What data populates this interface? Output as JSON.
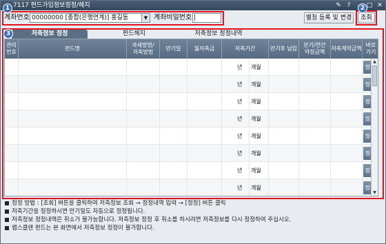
{
  "window": {
    "title": "7117 펀드가입정보정정/해지",
    "controls": [
      "pin-icon",
      "help-icon",
      "minimize-icon",
      "maximize-icon",
      "close-icon"
    ]
  },
  "markers": [
    "1",
    "2",
    "3"
  ],
  "account": {
    "label": "계좌번호",
    "value": "00000000 [종합(은행연계)] 홍길동",
    "password_label": "계좌비밀번호",
    "password_value": "|"
  },
  "buttons": {
    "register_change": "별청 등록 및 변경",
    "search": "조회"
  },
  "tabs": [
    "저축정보 정정",
    "펀드해지",
    "저축정보 정정내역"
  ],
  "grid": {
    "columns": [
      "관리\n번호",
      "펀드명",
      "과세방법/\n저축방법",
      "만기일",
      "월저축금",
      "저축기간",
      "만기후 납입",
      "분기/연간\n약정금액",
      "저축계약금액",
      "바로\n가기"
    ],
    "rows": [
      {
        "year": "년",
        "month": "개월",
        "action": "정정"
      },
      {
        "year": "년",
        "month": "개월",
        "action": "정정"
      },
      {
        "year": "년",
        "month": "개월",
        "action": "정정"
      },
      {
        "year": "년",
        "month": "개월",
        "action": "정정"
      },
      {
        "year": "년",
        "month": "개월",
        "action": "정정"
      },
      {
        "year": "년",
        "month": "개월",
        "action": "정정"
      },
      {
        "year": "년",
        "month": "개월",
        "action": "정정"
      },
      {
        "year": "년",
        "month": "개월",
        "action": "정정"
      }
    ]
  },
  "notes": [
    "정정 방법 : [조회] 버튼을 클릭하여 저축정보 조회 → 정정내역 입력 → [정정] 버튼 클릭",
    "저축기간을 정정하시면 만기일도 자동으로 정정됩니다.",
    "저축정보 정정내역은 취소가 불가능합니다. 저축정보 정정 후 취소를 하시려면 저축정보를 다시 정정하여 주십시오.",
    "랩스클랜 펀드는 본 화면에서 저축정보 정정이 불가합니다."
  ],
  "colors": {
    "highlight": "#e0141e",
    "marker": "#3a71b8",
    "header": "#5a6e84"
  }
}
